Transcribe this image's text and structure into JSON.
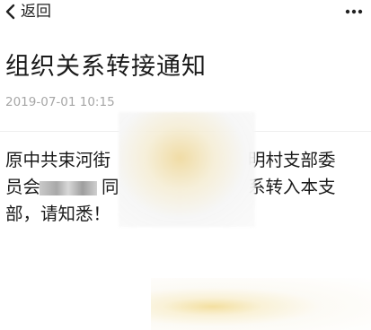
{
  "nav": {
    "back_label": "返回",
    "back_icon": "chevron-left-icon",
    "more_icon": "more-dots-icon"
  },
  "article": {
    "title": "组织关系转接通知",
    "timestamp": "2019-07-01 10:15",
    "body": {
      "line1_start": "原中共束河街",
      "line1_end": "明村支部委",
      "line2_start": "员会",
      "line2_mid": "同",
      "line2_end": "系转入本支",
      "line3": "部，请知悉！"
    }
  },
  "colors": {
    "text": "#1a1a1a",
    "timestamp": "#a6a6a6",
    "divider": "#efefef"
  }
}
